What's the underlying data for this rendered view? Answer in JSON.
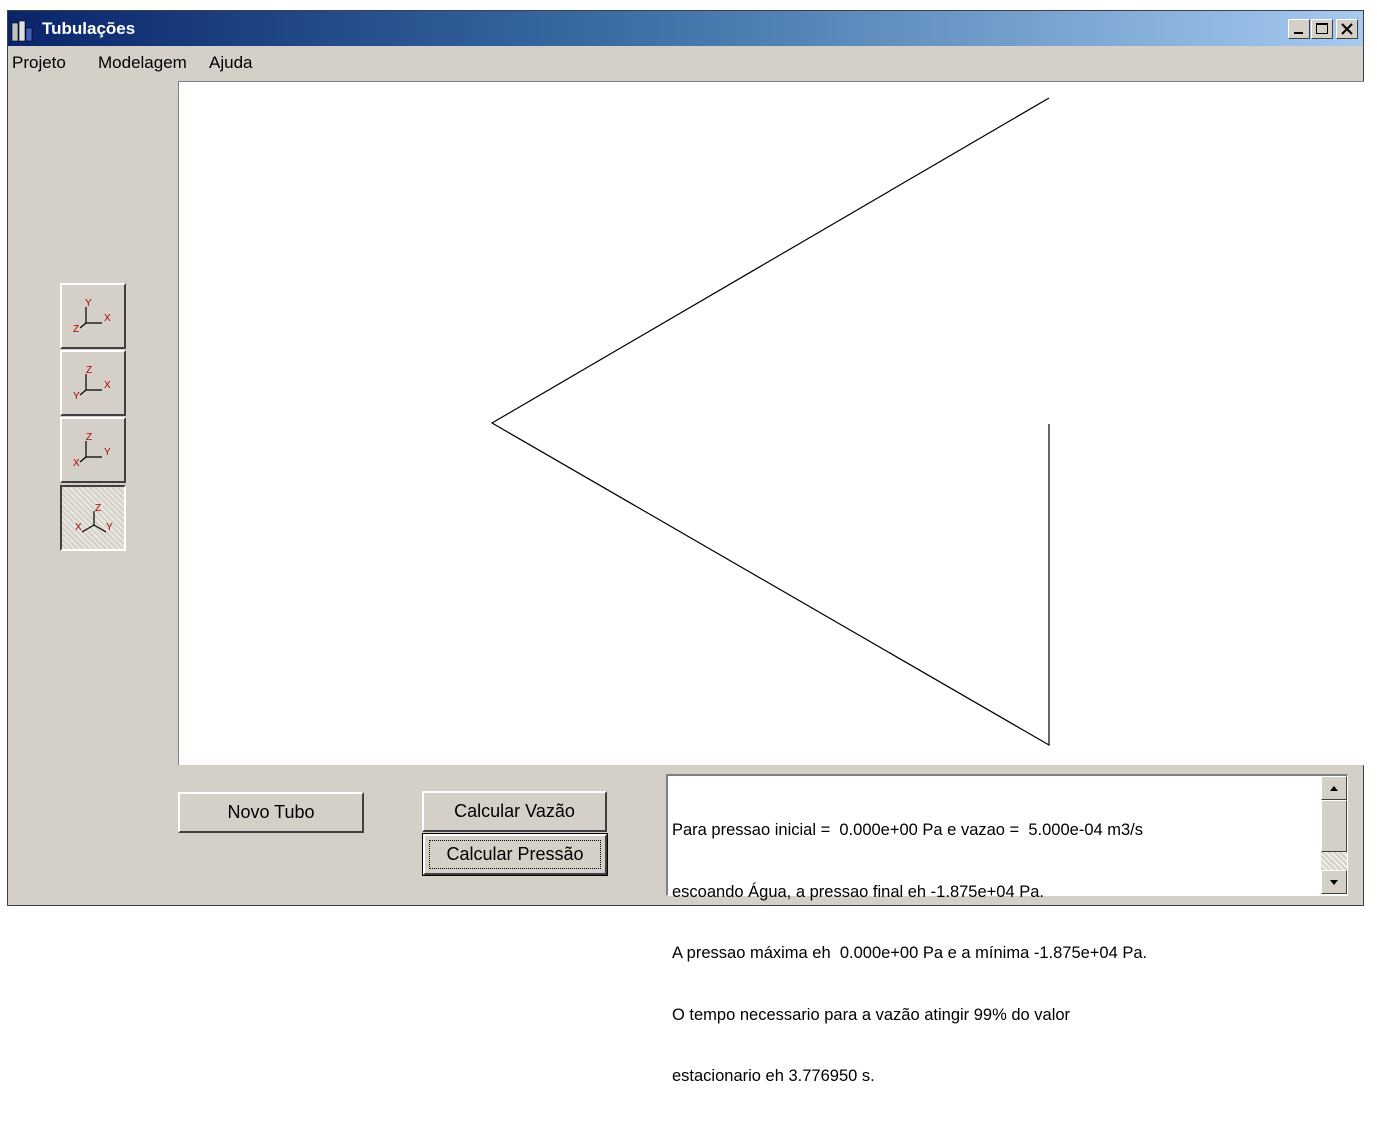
{
  "window": {
    "title": "Tubulações",
    "app_icon": "building-icon",
    "controls": [
      "minimize-icon",
      "maximize-icon",
      "close-icon"
    ]
  },
  "menu": {
    "items": [
      {
        "label": "Projeto"
      },
      {
        "label": "Modelagem"
      },
      {
        "label": "Ajuda"
      }
    ]
  },
  "views": {
    "buttons": [
      {
        "icon": "axes-xy-view-icon",
        "axis_up": "Y",
        "axis_right": "X",
        "axis_out": "Z",
        "pressed": false
      },
      {
        "icon": "axes-xz-view-icon",
        "axis_up": "Z",
        "axis_right": "X",
        "axis_out": "Y",
        "pressed": false
      },
      {
        "icon": "axes-yz-view-icon",
        "axis_up": "Z",
        "axis_right": "Y",
        "axis_out": "X",
        "pressed": false
      },
      {
        "icon": "axes-isometric-view-icon",
        "axis_up": "Z",
        "axis_right": "Y",
        "axis_out": "X",
        "pressed": true
      }
    ]
  },
  "actions": {
    "novo_tubo": "Novo Tubo",
    "calcular_vazao": "Calcular Vazão",
    "calcular_pressao": "Calcular Pressão"
  },
  "output": {
    "lines": [
      "Para pressao inicial =  0.000e+00 Pa e vazao =  5.000e-04 m3/s",
      "escoando Água, a pressao final eh -1.875e+04 Pa.",
      "A pressao máxima eh  0.000e+00 Pa e a mínima -1.875e+04 Pa.",
      "O tempo necessario para a vazão atingir 99% do valor",
      "estacionario eh 3.776950 s."
    ]
  },
  "colors": {
    "titlebar_start": "#0a246a",
    "titlebar_end": "#a6caf0",
    "face": "#d4d0c8",
    "axis_label": "#b00000"
  }
}
